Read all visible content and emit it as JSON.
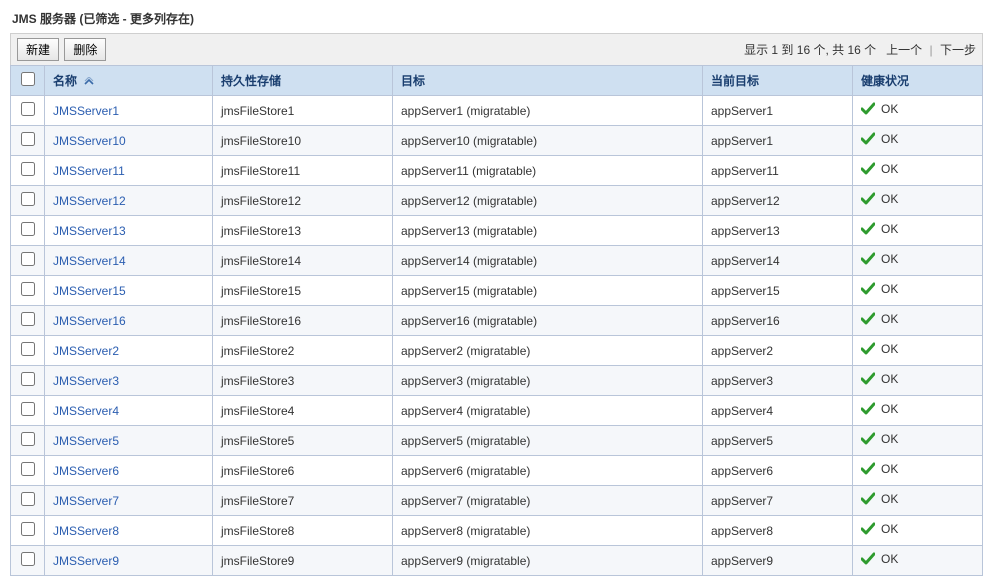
{
  "title": "JMS 服务器 (已筛选 - 更多列存在)",
  "toolbar": {
    "new_label": "新建",
    "delete_label": "删除"
  },
  "pager": {
    "range_text": "显示 1 到 16 个, 共 16 个",
    "prev_label": "上一个",
    "next_label": "下一步"
  },
  "columns": {
    "name": "名称",
    "store": "持久性存储",
    "target": "目标",
    "current_target": "当前目标",
    "health": "健康状况"
  },
  "health_ok_label": "OK",
  "rows": [
    {
      "name": "JMSServer1",
      "store": "jmsFileStore1",
      "target": "appServer1 (migratable)",
      "current": "appServer1",
      "health": "OK"
    },
    {
      "name": "JMSServer10",
      "store": "jmsFileStore10",
      "target": "appServer10 (migratable)",
      "current": "appServer1",
      "health": "OK"
    },
    {
      "name": "JMSServer11",
      "store": "jmsFileStore11",
      "target": "appServer11 (migratable)",
      "current": "appServer11",
      "health": "OK"
    },
    {
      "name": "JMSServer12",
      "store": "jmsFileStore12",
      "target": "appServer12 (migratable)",
      "current": "appServer12",
      "health": "OK"
    },
    {
      "name": "JMSServer13",
      "store": "jmsFileStore13",
      "target": "appServer13 (migratable)",
      "current": "appServer13",
      "health": "OK"
    },
    {
      "name": "JMSServer14",
      "store": "jmsFileStore14",
      "target": "appServer14 (migratable)",
      "current": "appServer14",
      "health": "OK"
    },
    {
      "name": "JMSServer15",
      "store": "jmsFileStore15",
      "target": "appServer15 (migratable)",
      "current": "appServer15",
      "health": "OK"
    },
    {
      "name": "JMSServer16",
      "store": "jmsFileStore16",
      "target": "appServer16 (migratable)",
      "current": "appServer16",
      "health": "OK"
    },
    {
      "name": "JMSServer2",
      "store": "jmsFileStore2",
      "target": "appServer2 (migratable)",
      "current": "appServer2",
      "health": "OK"
    },
    {
      "name": "JMSServer3",
      "store": "jmsFileStore3",
      "target": "appServer3 (migratable)",
      "current": "appServer3",
      "health": "OK"
    },
    {
      "name": "JMSServer4",
      "store": "jmsFileStore4",
      "target": "appServer4 (migratable)",
      "current": "appServer4",
      "health": "OK"
    },
    {
      "name": "JMSServer5",
      "store": "jmsFileStore5",
      "target": "appServer5 (migratable)",
      "current": "appServer5",
      "health": "OK"
    },
    {
      "name": "JMSServer6",
      "store": "jmsFileStore6",
      "target": "appServer6 (migratable)",
      "current": "appServer6",
      "health": "OK"
    },
    {
      "name": "JMSServer7",
      "store": "jmsFileStore7",
      "target": "appServer7 (migratable)",
      "current": "appServer7",
      "health": "OK"
    },
    {
      "name": "JMSServer8",
      "store": "jmsFileStore8",
      "target": "appServer8 (migratable)",
      "current": "appServer8",
      "health": "OK"
    },
    {
      "name": "JMSServer9",
      "store": "jmsFileStore9",
      "target": "appServer9 (migratable)",
      "current": "appServer9",
      "health": "OK"
    }
  ]
}
